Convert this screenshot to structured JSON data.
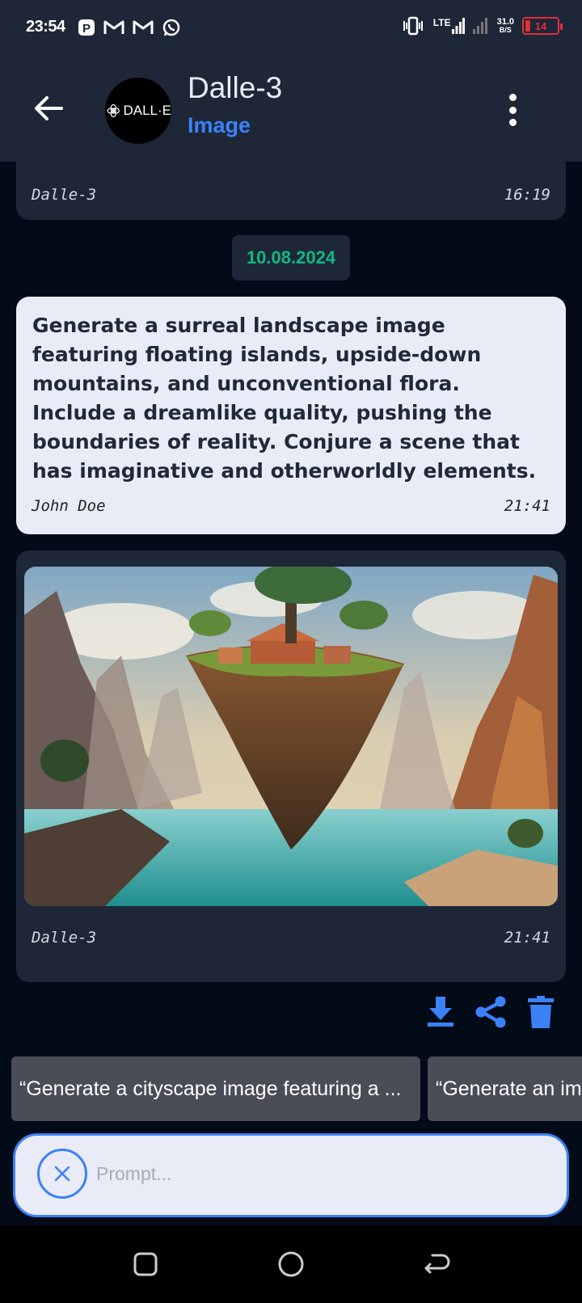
{
  "status_bar": {
    "time": "23:54",
    "network_label": "LTE",
    "speed_value": "31.0",
    "speed_unit": "B/S",
    "battery_level": "14",
    "notification_icons": [
      "p-app-icon",
      "gmail-icon",
      "gmail-icon",
      "whatsapp-icon"
    ]
  },
  "header": {
    "avatar_text": "DALL·E",
    "title": "Dalle-3",
    "subtitle": "Image"
  },
  "messages": [
    {
      "sender": "Dalle-3",
      "time": "16:19"
    },
    {
      "type": "date",
      "text": "10.08.2024"
    },
    {
      "sender": "John Doe",
      "time": "21:41",
      "text": "Generate a surreal landscape image featuring floating islands, upside-down mountains, and unconventional flora. Include a dreamlike quality, pushing the boundaries of reality. Conjure a scene that has imaginative and otherworldly elements."
    },
    {
      "sender": "Dalle-3",
      "time": "21:41",
      "image": "surreal floating island landscape"
    }
  ],
  "suggestions": [
    "“Generate a cityscape image featuring a ...",
    "“Generate an im"
  ],
  "prompt": {
    "placeholder": "Prompt..."
  },
  "colors": {
    "accent": "#3b82f6",
    "date": "#10b981",
    "surface": "#1e2738",
    "background": "#030a18"
  }
}
